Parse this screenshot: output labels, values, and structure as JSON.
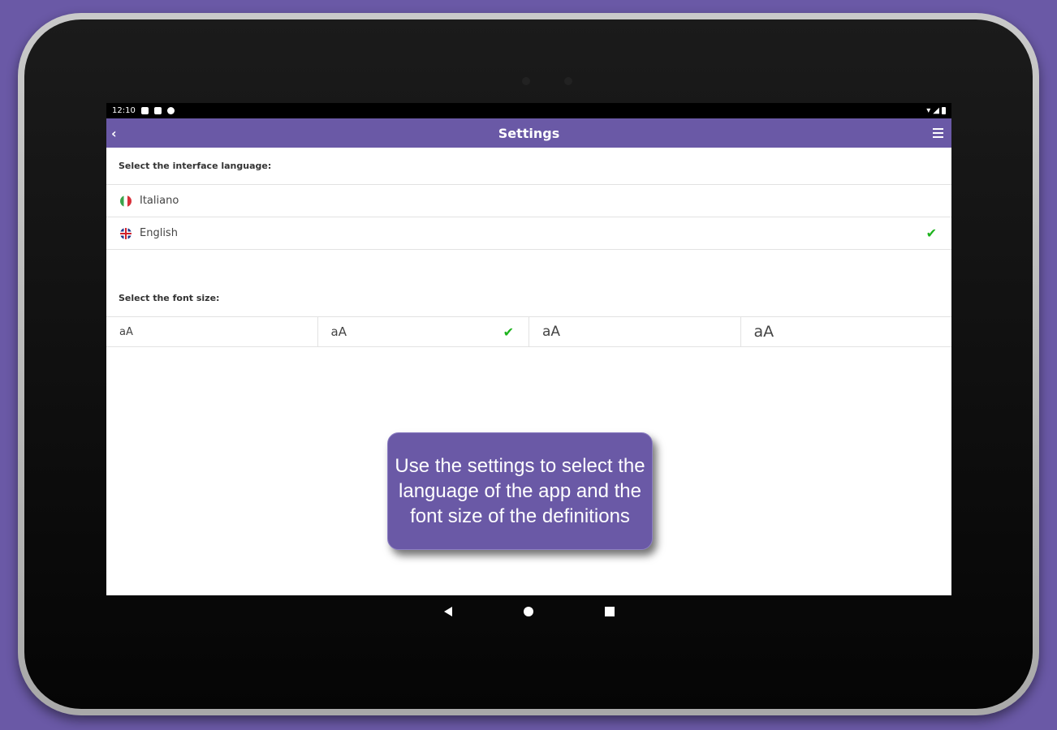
{
  "status_bar": {
    "time": "12:10"
  },
  "app_bar": {
    "title": "Settings",
    "back_icon": "chevron-left-icon",
    "menu_icon": "hamburger-menu-icon"
  },
  "language_section": {
    "label": "Select the interface language:",
    "options": [
      {
        "label": "Italiano",
        "flag": "italy-flag-icon",
        "selected": false
      },
      {
        "label": "English",
        "flag": "uk-flag-icon",
        "selected": true
      }
    ]
  },
  "font_section": {
    "label": "Select the font size:",
    "options": [
      {
        "label": "aA",
        "selected": false
      },
      {
        "label": "aA",
        "selected": true
      },
      {
        "label": "aA",
        "selected": false
      },
      {
        "label": "aA",
        "selected": false
      }
    ]
  },
  "tooltip": {
    "text": "Use the settings to select the language of the app and the font size of the definitions"
  },
  "colors": {
    "accent": "#6a59a6",
    "check": "#1db31d",
    "background": "#6a59a6"
  }
}
